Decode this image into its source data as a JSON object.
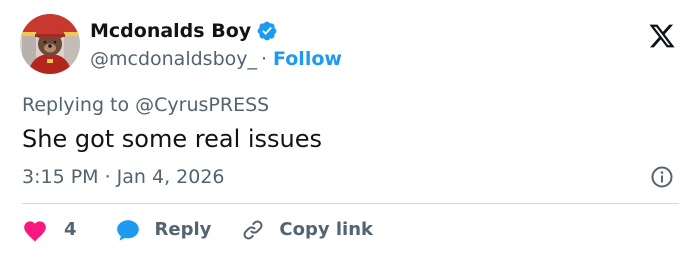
{
  "author": {
    "display_name": "Mcdonalds Boy",
    "handle": "@mcdonaldsboy_",
    "separator": "·",
    "follow_label": "Follow",
    "verified": true,
    "avatar_icon": "bear-mascot-avatar"
  },
  "reply_to": "Replying to @CyrusPRESS",
  "text": "She got some real issues",
  "timestamp": "3:15 PM · Jan 4, 2026",
  "actions": {
    "like_count": "4",
    "reply_label": "Reply",
    "copy_label": "Copy link"
  },
  "icons": {
    "brand": "x-logo-icon",
    "info": "info-icon",
    "like": "heart-icon",
    "reply": "speech-bubble-icon",
    "copy": "link-icon"
  },
  "colors": {
    "text": "#0f1419",
    "secondary": "#536471",
    "accent": "#1d9bf0",
    "like": "#f91880",
    "divider": "#cfd9de"
  }
}
